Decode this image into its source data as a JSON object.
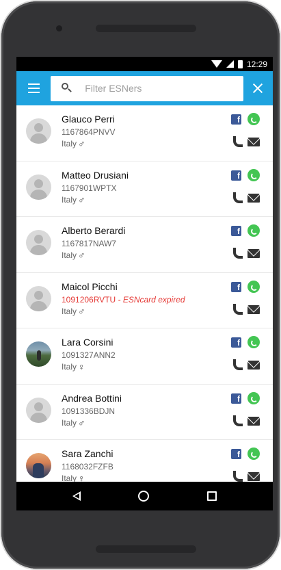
{
  "status_bar": {
    "time": "12:29",
    "icons": [
      "wifi-icon",
      "signal-icon",
      "battery-icon"
    ]
  },
  "app_bar": {
    "menu_icon": "hamburger-menu-icon",
    "search": {
      "placeholder": "Filter ESNers",
      "value": ""
    },
    "close_icon": "close-icon",
    "color": "#1fa3df"
  },
  "contacts": [
    {
      "name": "Glauco Perri",
      "code": "1167864PNVV",
      "expired_note": "",
      "country": "Italy",
      "gender": "♂",
      "avatar": "default"
    },
    {
      "name": "Matteo Drusiani",
      "code": "1167901WPTX",
      "expired_note": "",
      "country": "Italy",
      "gender": "♂",
      "avatar": "default"
    },
    {
      "name": "Alberto Berardi",
      "code": "1167817NAW7",
      "expired_note": "",
      "country": "Italy",
      "gender": "♂",
      "avatar": "default"
    },
    {
      "name": "Maicol Picchi",
      "code": "1091206RVTU",
      "expired_note": " - ESNcard expired",
      "country": "Italy",
      "gender": "♂",
      "avatar": "default"
    },
    {
      "name": "Lara Corsini",
      "code": "1091327ANN2",
      "expired_note": "",
      "country": "Italy",
      "gender": "♀",
      "avatar": "photo"
    },
    {
      "name": "Andrea Bottini",
      "code": "1091336BDJN",
      "expired_note": "",
      "country": "Italy",
      "gender": "♂",
      "avatar": "default"
    },
    {
      "name": "Sara Zanchi",
      "code": "1168032FZFB",
      "expired_note": "",
      "country": "Italy",
      "gender": "♀",
      "avatar": "photo"
    }
  ],
  "row_actions": [
    "facebook-icon",
    "whatsapp-icon",
    "phone-icon",
    "mail-icon"
  ],
  "colors": {
    "facebook": "#3b5998",
    "whatsapp": "#43c553",
    "expired": "#e53935"
  },
  "nav_bar": {
    "icons": [
      "back-icon",
      "home-icon",
      "recents-icon"
    ]
  }
}
